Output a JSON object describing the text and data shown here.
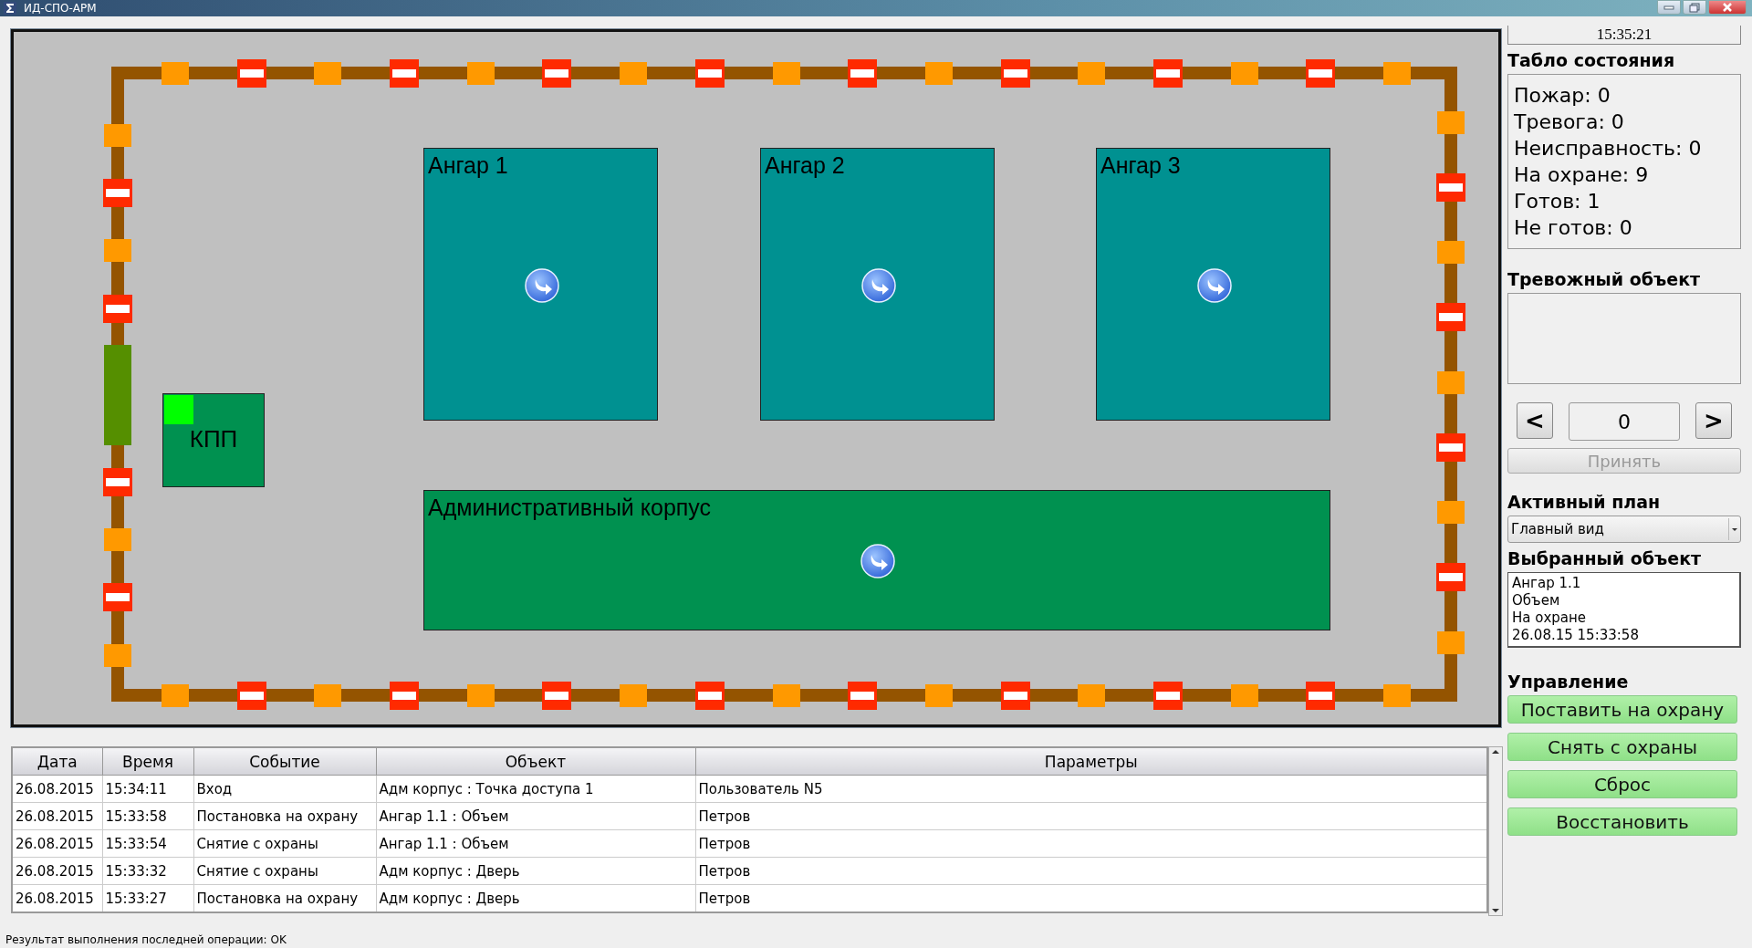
{
  "window": {
    "title": "ИД-СПО-АРМ"
  },
  "map": {
    "perimeter": {
      "top": [
        {
          "kind": "detector"
        },
        {
          "kind": "barrier"
        },
        {
          "kind": "detector"
        },
        {
          "kind": "barrier"
        },
        {
          "kind": "detector"
        },
        {
          "kind": "barrier"
        },
        {
          "kind": "detector"
        },
        {
          "kind": "barrier"
        },
        {
          "kind": "detector"
        },
        {
          "kind": "barrier"
        },
        {
          "kind": "detector"
        },
        {
          "kind": "barrier"
        },
        {
          "kind": "detector"
        },
        {
          "kind": "barrier"
        },
        {
          "kind": "detector"
        },
        {
          "kind": "barrier"
        },
        {
          "kind": "detector"
        }
      ],
      "right": [
        {
          "kind": "detector"
        },
        {
          "kind": "barrier"
        },
        {
          "kind": "detector"
        },
        {
          "kind": "barrier"
        },
        {
          "kind": "detector"
        },
        {
          "kind": "barrier"
        },
        {
          "kind": "detector"
        },
        {
          "kind": "barrier"
        },
        {
          "kind": "detector"
        }
      ],
      "bottom": [
        {
          "kind": "detector"
        },
        {
          "kind": "barrier"
        },
        {
          "kind": "detector"
        },
        {
          "kind": "barrier"
        },
        {
          "kind": "detector"
        },
        {
          "kind": "barrier"
        },
        {
          "kind": "detector"
        },
        {
          "kind": "barrier"
        },
        {
          "kind": "detector"
        },
        {
          "kind": "barrier"
        },
        {
          "kind": "detector"
        },
        {
          "kind": "barrier"
        },
        {
          "kind": "detector"
        },
        {
          "kind": "barrier"
        },
        {
          "kind": "detector"
        },
        {
          "kind": "barrier"
        },
        {
          "kind": "detector"
        }
      ],
      "left": [
        {
          "kind": "detector"
        },
        {
          "kind": "barrier"
        },
        {
          "kind": "detector"
        },
        {
          "kind": "barrier"
        },
        {
          "kind": "gate"
        },
        {
          "kind": "barrier"
        },
        {
          "kind": "detector"
        },
        {
          "kind": "barrier"
        },
        {
          "kind": "detector"
        }
      ]
    },
    "buildings": [
      {
        "name": "Ангар 1",
        "kind": "hangar",
        "color": "#009191"
      },
      {
        "name": "Ангар 2",
        "kind": "hangar",
        "color": "#009191"
      },
      {
        "name": "Ангар 3",
        "kind": "hangar",
        "color": "#009191"
      },
      {
        "name": "Административный корпус",
        "kind": "admin",
        "color": "#009150"
      },
      {
        "name": "КПП",
        "kind": "checkpoint",
        "color": "#009150",
        "indicator": true
      }
    ]
  },
  "clock": "15:35:21",
  "status_board": {
    "title": "Табло состояния",
    "lines": [
      "Пожар: 0",
      "Тревога: 0",
      "Неисправность: 0",
      "На охране: 9",
      "Готов: 1",
      "Не готов: 0"
    ]
  },
  "alarm_object": {
    "title": "Тревожный объект",
    "prev": "<",
    "value": "0",
    "next": ">",
    "accept": {
      "label": "Принять",
      "disabled": true
    }
  },
  "active_plan": {
    "title": "Активный план",
    "value": "Главный вид"
  },
  "selected_object": {
    "title": "Выбранный объект",
    "lines": [
      "Ангар 1.1",
      "Объем",
      "На охране",
      "26.08.15 15:33:58"
    ]
  },
  "control": {
    "title": "Управление",
    "buttons": [
      "Поставить на охрану",
      "Снять с охраны",
      "Сброс",
      "Восстановить"
    ]
  },
  "events": {
    "columns": [
      "Дата",
      "Время",
      "Событие",
      "Объект",
      "Параметры"
    ],
    "rows": [
      [
        "26.08.2015",
        "15:34:11",
        "Вход",
        "Адм корпус : Точка доступа 1",
        "Пользователь N5"
      ],
      [
        "26.08.2015",
        "15:33:58",
        "Постановка на охрану",
        "Ангар 1.1 : Объем",
        "Петров"
      ],
      [
        "26.08.2015",
        "15:33:54",
        "Снятие с охраны",
        "Ангар 1.1 : Объем",
        "Петров"
      ],
      [
        "26.08.2015",
        "15:33:32",
        "Снятие с охраны",
        "Адм корпус : Дверь",
        "Петров"
      ],
      [
        "26.08.2015",
        "15:33:27",
        "Постановка на охрану",
        "Адм корпус : Дверь",
        "Петров"
      ]
    ]
  },
  "status_bar": "Результат выполнения последней операции: OK"
}
